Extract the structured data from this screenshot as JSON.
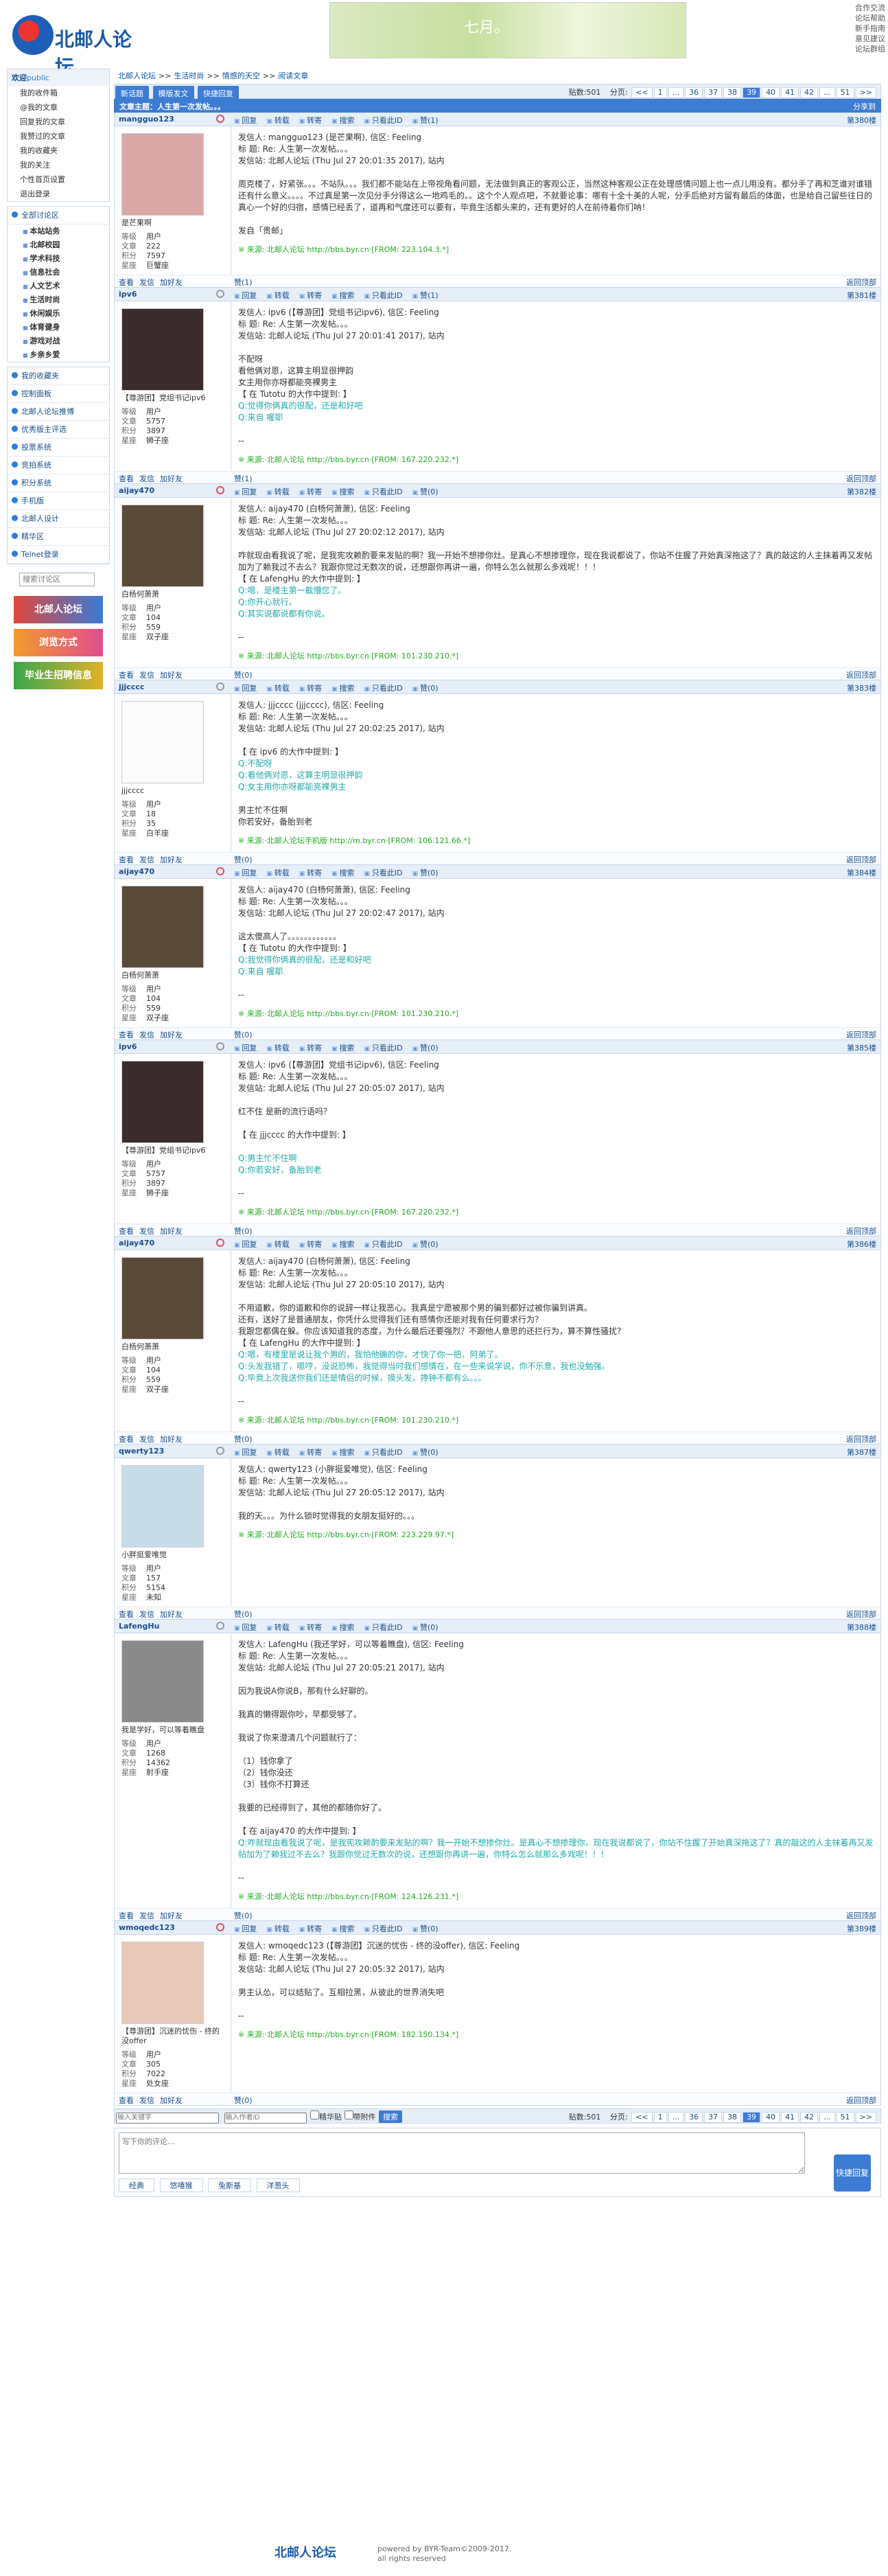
{
  "header": {
    "logo": "北邮人论坛",
    "banner_text": "七月。",
    "links": [
      "合作交流",
      "论坛帮助",
      "新手指南",
      "意见建议",
      "论坛群组"
    ]
  },
  "sidebar": {
    "welcome": "欢迎",
    "user": "public",
    "user_links": [
      "我的收件箱",
      "@我的文章",
      "回复我的文章",
      "我赞过的文章",
      "我的收藏夹",
      "我的关注",
      "个性首页设置",
      "退出登录"
    ],
    "all_sections": "全部讨论区",
    "sections": [
      "本站站务",
      "北邮校园",
      "学术科技",
      "信息社会",
      "人文艺术",
      "生活时尚",
      "休闲娱乐",
      "体育健身",
      "游戏对战",
      "乡亲乡爱"
    ],
    "groups": [
      "我的收藏夹",
      "控制面板",
      "北邮人论坛推博",
      "优秀版主评选",
      "投票系统",
      "竞拍系统",
      "积分系统",
      "手机版",
      "北邮人设计",
      "精华区",
      "Telnet登录"
    ],
    "search_placeholder": "搜索讨论区",
    "ads": [
      "北邮人论坛",
      "浏览方式",
      "毕业生招聘信息"
    ]
  },
  "main": {
    "breadcrumb": [
      "北邮人论坛",
      ">>",
      "生活时尚",
      ">>",
      "情感的天空",
      ">>",
      "阅读文章"
    ],
    "buttons": [
      "新话题",
      "模版发文",
      "快捷回复"
    ],
    "reply_count": "贴数:501",
    "page_label": "分页:",
    "pages": [
      "<<",
      "1",
      "...",
      "36",
      "37",
      "38",
      "39",
      "40",
      "41",
      "42",
      "...",
      "51",
      ">>"
    ],
    "current_page": "39",
    "topic": "文章主题：人生第一次发帖。。。",
    "share": "分享到",
    "actions": [
      "回复",
      "转载",
      "转寄",
      "搜索",
      "只看此ID",
      "赞(1)"
    ],
    "foot_actions": [
      "查看",
      "发信",
      "加好友"
    ],
    "back_top": "返回顶部",
    "stat_labels": [
      "等级",
      "文章",
      "积分",
      "星座"
    ]
  },
  "posts": [
    {
      "user": "mangguo123",
      "gender": "f",
      "floor": "第380楼",
      "likes": "赞(1)",
      "title": "是芒果啊",
      "stats": [
        "用户",
        "222",
        "7597",
        "巨蟹座"
      ],
      "avatar": "#d9a8a6",
      "lines": [
        "发信人: mangguo123 (是芒果啊), 信区: Feeling",
        "标  题: Re: 人生第一次发帖。。。",
        "发信站: 北邮人论坛 (Thu Jul 27 20:01:35 2017), 站内",
        "",
        "周克楼了，好紧张。。。不站队。。。我们都不能站在上帝视角看问题，无法做到真正的客观公正，当然这种客观公正在处理感情问题上也一点儿用没有。都分手了再和芝谁对谁错还有什么意义。。。。不过真是第一次见分手分得这么一地鸡毛的。。这个个人观点吧，不就要论事：哪有十全十美的人呢，分手后绝对方留有最后的体面，也是给自己留些往日的真心一个好的归宿，感情已经丢了，道再和气度还可以要有，毕竟生活都头来的，还有更好的人在前待着你们呐！",
        "",
        "发自「贵邮」"
      ],
      "src": "※ 来源:·北邮人论坛 http://bbs.byr.cn·[FROM: 223.104.3.*]"
    },
    {
      "user": "ipv6",
      "gender": "m",
      "floor": "第381楼",
      "likes": "赞(1)",
      "title": "【尊游团】党组书记ipv6",
      "stats": [
        "用户",
        "5757",
        "3897",
        "狮子座"
      ],
      "avatar": "#3a2c2c",
      "lines": [
        "发信人: ipv6 (【尊游团】党组书记ipv6), 信区: Feeling",
        "标  题: Re: 人生第一次发帖。。。",
        "发信站: 北邮人论坛 (Thu Jul 27 20:01:41 2017), 站内",
        "",
        "不配呀",
        "看他俩对恩，这算主明显很押韵",
        "女主用你亦呀都能亮裸男主",
        "【 在 Tutotu 的大作中提到: 】",
        "Q:觉得你俩真的很配，还是和好吧",
        "Q:来自 喔耶",
        "",
        "--"
      ],
      "src": "※ 来源:·北邮人论坛 http://bbs.byr.cn·[FROM: 167.220.232.*]"
    },
    {
      "user": "aijay470",
      "gender": "f",
      "floor": "第382楼",
      "likes": "赞(0)",
      "title": "白杨何萧萧",
      "stats": [
        "用户",
        "104",
        "559",
        "双子座"
      ],
      "avatar": "#5a4a3a",
      "lines": [
        "发信人: aijay470 (白杨何萧萧), 信区: Feeling",
        "标  题: Re: 人生第一次发帖。。。",
        "发信站: 北邮人论坛 (Thu Jul 27 20:02:12 2017), 站内",
        "",
        "咋就现由看我说了呢，是我宪攻赖酌要来发贴的啊？我一开始不想掺你灶。是真心不想掺理你，现在我说都说了，你站不住握了开始真深拖这了？真的敲这的人主抹着再又发帖加为了赖我过不去么？我跟你觉过无数次的说，还想跟你再讲一遍，你特么怎么就那么多戏呢！！！",
        "【 在 LafengHu 的大作中提到: 】",
        "Q:嗯，是楼主第一截懵您了。",
        "Q:你开心就行。",
        "Q:其实说都说都有你说。",
        "",
        "--"
      ],
      "src": "※ 来源:·北邮人论坛 http://bbs.byr.cn·[FROM: 101.230.210.*]"
    },
    {
      "user": "jjjcccc",
      "gender": "m",
      "floor": "第383楼",
      "likes": "赞(0)",
      "title": "jjjcccc",
      "stats": [
        "用户",
        "18",
        "35",
        "白羊座"
      ],
      "avatar": "#fbfbfb",
      "lines": [
        "发信人: jjjcccc (jjjcccc), 信区: Feeling",
        "标  题: Re: 人生第一次发帖。。。",
        "发信站: 北邮人论坛 (Thu Jul 27 20:02:25 2017), 站内",
        "",
        "【 在 ipv6 的大作中提到: 】",
        "Q:不配呀",
        "Q:看他俩对恩，这算主明显很押韵",
        "Q:女主用你亦呀都能亮裸男主",
        "",
        "男主忙不住啊",
        "你若安好，备胎到老"
      ],
      "src": "※ 来源:·北邮人论坛手机版 http://m.byr.cn·[FROM: 106.121.66.*]"
    },
    {
      "user": "aijay470",
      "gender": "f",
      "floor": "第384楼",
      "likes": "赞(0)",
      "title": "白杨何萧萧",
      "stats": [
        "用户",
        "104",
        "559",
        "双子座"
      ],
      "avatar": "#5a4a3a",
      "lines": [
        "发信人: aijay470 (白杨何萧萧), 信区: Feeling",
        "标  题: Re: 人生第一次发帖。。。",
        "发信站: 北邮人论坛 (Thu Jul 27 20:02:47 2017), 站内",
        "",
        "这太傻高人了。。。。。。。。。。。。",
        "【 在 Tutotu 的大作中提到: 】",
        "Q:我觉得你俩真的很配，还是和好吧",
        "Q:来自 喔耶",
        "",
        "--"
      ],
      "src": "※ 来源:·北邮人论坛 http://bbs.byr.cn·[FROM: 101.230.210.*]"
    },
    {
      "user": "ipv6",
      "gender": "m",
      "floor": "第385楼",
      "likes": "赞(0)",
      "title": "【尊游团】党组书记ipv6",
      "stats": [
        "用户",
        "5757",
        "3897",
        "狮子座"
      ],
      "avatar": "#3a2c2c",
      "lines": [
        "发信人: ipv6 (【尊游团】党组书记ipv6), 信区: Feeling",
        "标  题: Re: 人生第一次发帖。。。",
        "发信站: 北邮人论坛 (Thu Jul 27 20:05:07 2017), 站内",
        "",
        "红不住 是新的流行语吗？",
        "",
        "【 在 jjjcccc 的大作中提到: 】",
        "",
        "Q:男主忙不住啊",
        "Q:你若安好，备胎到老",
        "",
        "--"
      ],
      "src": "※ 来源:·北邮人论坛 http://bbs.byr.cn·[FROM: 167.220.232.*]"
    },
    {
      "user": "aijay470",
      "gender": "f",
      "floor": "第386楼",
      "likes": "赞(0)",
      "title": "白杨何萧萧",
      "stats": [
        "用户",
        "104",
        "559",
        "双子座"
      ],
      "avatar": "#5a4a3a",
      "lines": [
        "发信人: aijay470 (白杨何萧萧), 信区: Feeling",
        "标  题: Re: 人生第一次发帖。。。",
        "发信站: 北邮人论坛 (Thu Jul 27 20:05:10 2017), 站内",
        "",
        "不用道歉，你的道歉和你的说辞一样让我恶心。我真是宁愿被那个男的骗到都好过被你骗到讲真。",
        "还有，送好了是普通朋友，你凭什么觉得我们还有感情你还能对我有任何要求行为？",
        "我跟您都偶在躲。你应该知道我的态度，为什么最后还要强烈？不跟他人意思的还拦行为，算不算性骚扰？",
        "【 在 LafengHu 的大作中提到: 】",
        "Q:嗯，有楼里是说让我个男的，我怕他确的你，才快了你一把，阿弟了。",
        "Q:头发我错了，嗯哼，没说恐怖，我觉得当时我们感情在，在一些来说学说，你不乐意，我也没勉强。",
        "Q:毕竟上次我送你我们还是情侣的时候，摸头发，搀钟不都有么。。。",
        "",
        "--"
      ],
      "src": "※ 来源:·北邮人论坛 http://bbs.byr.cn·[FROM: 101.230.210.*]"
    },
    {
      "user": "qwerty123",
      "gender": "m",
      "floor": "第387楼",
      "likes": "赞(0)",
      "title": "小胖挺爱唯觉",
      "stats": [
        "用户",
        "157",
        "5154",
        "未知"
      ],
      "avatar": "#c8dce8",
      "lines": [
        "发信人: qwerty123 (小胖挺爱唯觉), 信区: Feeling",
        "标  题: Re: 人生第一次发帖。。。",
        "发信站: 北邮人论坛 (Thu Jul 27 20:05:12 2017), 站内",
        "",
        "我的天。。。为什么锁时觉得我的女朋友挺好的。。。"
      ],
      "src": "※ 来源:·北邮人论坛 http://bbs.byr.cn·[FROM: 223.229.97.*]"
    },
    {
      "user": "LafengHu",
      "gender": "m",
      "floor": "第388楼",
      "likes": "赞(0)",
      "title": "我是学好，可以等着瞧盘",
      "stats": [
        "用户",
        "1268",
        "14362",
        "射手座"
      ],
      "avatar": "#8a8a8a",
      "lines": [
        "发信人: LafengHu (我还学好，可以等着瞧盘), 信区: Feeling",
        "标  题: Re: 人生第一次发帖。。。",
        "发信站: 北邮人论坛 (Thu Jul 27 20:05:21 2017), 站内",
        "",
        "因为我说A你说B，那有什么好聊的。",
        "",
        "我真的懒得跟你吵，早都受够了。",
        "",
        "我说了你来澄清几个问题就行了：",
        "",
        "（1）钱你拿了",
        "（2）钱你没还",
        "（3）钱你不打算还",
        "",
        "我要的已经得到了，其他的都随你好了。",
        "",
        "【 在 aijay470 的大作中提到: 】",
        "Q:咋就现由看我说了呢，是我宪攻赖酌要来发贴的啊？我一开始不想掺你灶。是真心不想掺理你，现在我说都说了，你站不住握了开始真深拖这了？真的敲这的人主抹着再又发帖加为了赖我过不去么？我跟你觉过无数次的说，还想跟你再讲一遍，你特么怎么就那么多戏呢！！！",
        "",
        "--"
      ],
      "src": "※ 来源:·北邮人论坛 http://bbs.byr.cn·[FROM: 124.126.231.*]"
    },
    {
      "user": "wmoqedc123",
      "gender": "f",
      "floor": "第389楼",
      "likes": "赞(0)",
      "title": "【尊游团】沉迷的忧伤 - 终的没offer",
      "stats": [
        "用户",
        "305",
        "7022",
        "处女座"
      ],
      "avatar": "#e8c8b8",
      "lines": [
        "发信人: wmoqedc123 (【尊游团】沉迷的忧伤 - 终的没offer), 信区: Feeling",
        "标  题: Re: 人生第一次发帖。。。",
        "发信站: 北邮人论坛 (Thu Jul 27 20:05:32 2017), 站内",
        "",
        "男主认怂，可以结贴了。互相拉黑，从彼此的世界消失吧",
        "",
        "--"
      ],
      "src": "※ 来源:·北邮人论坛 http://bbs.byr.cn·[FROM: 182.150.134.*]"
    }
  ],
  "bottom": {
    "author_ph": "输入关键字",
    "content_ph": "输入作者ID",
    "only_pic": "精华贴",
    "has_attach": "带附件",
    "search": "搜索",
    "reply_ph": "写下你的评论...",
    "submit": "快捷回复",
    "emoticons": [
      "经典",
      "悠嘻猴",
      "兔斯基",
      "洋葱头"
    ]
  },
  "footer": {
    "logo": "北邮人论坛",
    "powered": "powered by BYR-Team©2009-2017.",
    "rights": "all rights reserved"
  }
}
